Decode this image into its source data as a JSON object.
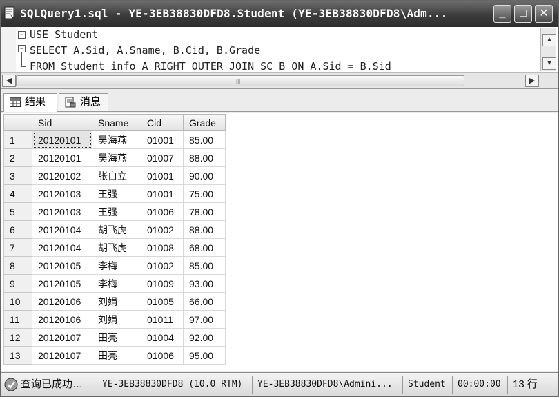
{
  "window": {
    "title": "SQLQuery1.sql - YE-3EB38830DFD8.Student (YE-3EB38830DFD8\\Adm...",
    "controls": {
      "minimize": "_",
      "maximize": "□",
      "close": "✕"
    }
  },
  "editor": {
    "lines": [
      "USE Student",
      "SELECT A.Sid, A.Sname, B.Cid, B.Grade",
      "FROM Student info A RIGHT OUTER JOIN SC B ON A.Sid = B.Sid"
    ]
  },
  "tabs": [
    {
      "label": "结果",
      "icon": "grid-icon",
      "active": true
    },
    {
      "label": "消息",
      "icon": "messages-icon",
      "active": false
    }
  ],
  "grid": {
    "columns": [
      "Sid",
      "Sname",
      "Cid",
      "Grade"
    ],
    "rows": [
      [
        "1",
        "20120101",
        "吴海燕",
        "01001",
        "85.00"
      ],
      [
        "2",
        "20120101",
        "吴海燕",
        "01007",
        "88.00"
      ],
      [
        "3",
        "20120102",
        "张自立",
        "01001",
        "90.00"
      ],
      [
        "4",
        "20120103",
        "王强",
        "01001",
        "75.00"
      ],
      [
        "5",
        "20120103",
        "王强",
        "01006",
        "78.00"
      ],
      [
        "6",
        "20120104",
        "胡飞虎",
        "01002",
        "88.00"
      ],
      [
        "7",
        "20120104",
        "胡飞虎",
        "01008",
        "68.00"
      ],
      [
        "8",
        "20120105",
        "李梅",
        "01002",
        "85.00"
      ],
      [
        "9",
        "20120105",
        "李梅",
        "01009",
        "93.00"
      ],
      [
        "10",
        "20120106",
        "刘娟",
        "01005",
        "66.00"
      ],
      [
        "11",
        "20120106",
        "刘娟",
        "01011",
        "97.00"
      ],
      [
        "12",
        "20120107",
        "田亮",
        "01004",
        "92.00"
      ],
      [
        "13",
        "20120107",
        "田亮",
        "01006",
        "95.00"
      ]
    ]
  },
  "status": {
    "message": "查询已成功…",
    "server": "YE-3EB38830DFD8 (10.0 RTM)",
    "user": "YE-3EB38830DFD8\\Admini...",
    "database": "Student",
    "elapsed": "00:00:00",
    "rows": "13 行"
  }
}
